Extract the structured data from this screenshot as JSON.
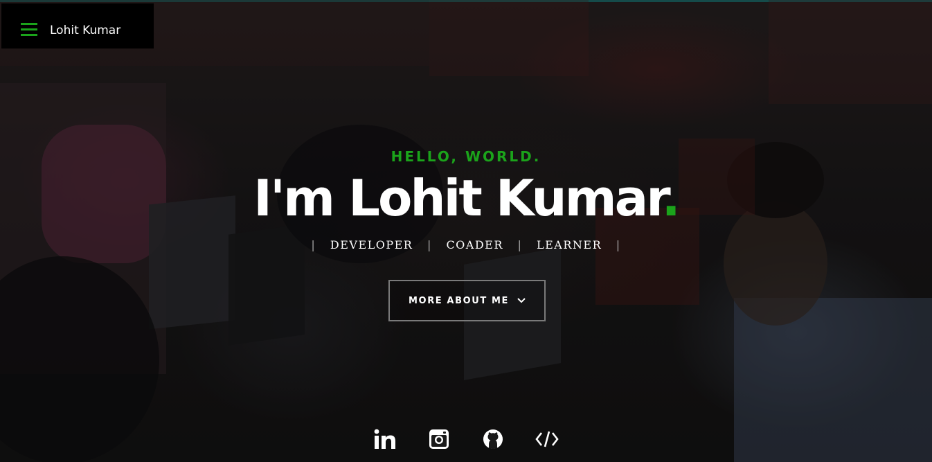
{
  "nav": {
    "brand": "Lohit Kumar",
    "menu_icon": "hamburger-menu-icon",
    "accent_color": "#1ba31b"
  },
  "hero": {
    "greeting": "HELLO, WORLD.",
    "headline": "I'm Lohit Kumar",
    "headline_dot": ".",
    "roles": [
      "DEVELOPER",
      "COADER",
      "LEARNER"
    ],
    "separator": "|",
    "cta_label": "MORE ABOUT ME",
    "cta_icon": "chevron-down-icon"
  },
  "social": [
    {
      "icon": "linkedin-icon",
      "label": "in"
    },
    {
      "icon": "instagram-icon"
    },
    {
      "icon": "github-icon"
    },
    {
      "icon": "code-icon",
      "label": "</>"
    }
  ],
  "colors": {
    "accent": "#1ba31b",
    "text": "#ffffff",
    "top_bar": "#1f6f6e",
    "button_border": "#7a7a7a"
  }
}
